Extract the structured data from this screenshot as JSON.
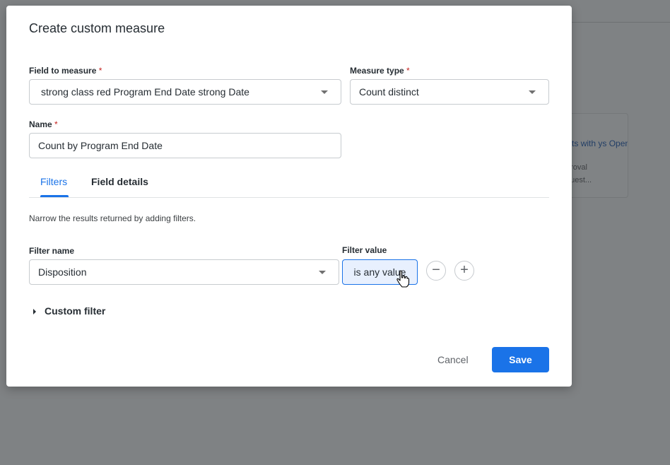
{
  "background": {
    "card_title": "quests with ys Open",
    "card_line1": "proval",
    "card_line2": "quest..."
  },
  "dialog": {
    "title": "Create custom measure",
    "field_to_measure": {
      "label": "Field to measure",
      "required_mark": "*",
      "value": "strong class red Program End Date strong  Date"
    },
    "measure_type": {
      "label": "Measure type",
      "required_mark": "*",
      "value": "Count distinct"
    },
    "name": {
      "label": "Name",
      "required_mark": "*",
      "value": "Count by Program End Date"
    },
    "tabs": [
      {
        "label": "Filters",
        "active": true
      },
      {
        "label": "Field details",
        "active": false
      }
    ],
    "filters_description": "Narrow the results returned by adding filters.",
    "filter_name_label": "Filter name",
    "filter_value_label": "Filter value",
    "filter": {
      "name": "Disposition",
      "value": "is any value"
    },
    "remove_symbol": "−",
    "add_symbol": "+",
    "custom_filter_label": "Custom filter",
    "cancel_label": "Cancel",
    "save_label": "Save"
  },
  "colors": {
    "accent": "#1a73e8",
    "required": "#c5221f",
    "overlay": "#7f8284"
  }
}
